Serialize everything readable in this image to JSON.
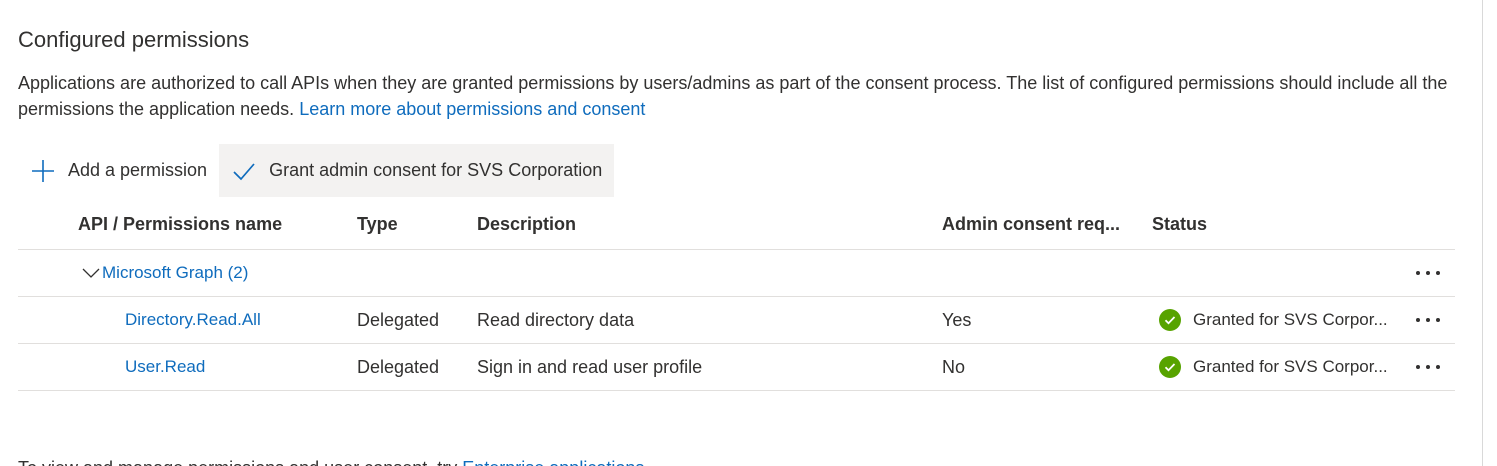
{
  "section": {
    "title": "Configured permissions",
    "intro_text": "Applications are authorized to call APIs when they are granted permissions by users/admins as part of the consent process. The list of configured permissions should include all the permissions the application needs.",
    "intro_link": "Learn more about permissions and consent"
  },
  "toolbar": {
    "add_label": "Add a permission",
    "grant_label": "Grant admin consent for SVS Corporation"
  },
  "table": {
    "headers": {
      "api": "API / Permissions name",
      "type": "Type",
      "description": "Description",
      "admin": "Admin consent req...",
      "status": "Status"
    },
    "group": {
      "label": "Microsoft Graph (2)"
    },
    "rows": [
      {
        "name": "Directory.Read.All",
        "type": "Delegated",
        "description": "Read directory data",
        "admin": "Yes",
        "status": "Granted for SVS Corpor..."
      },
      {
        "name": "User.Read",
        "type": "Delegated",
        "description": "Sign in and read user profile",
        "admin": "No",
        "status": "Granted for SVS Corpor..."
      }
    ]
  },
  "footer": {
    "text": "To view and manage permissions and user consent, try",
    "link": "Enterprise applications"
  },
  "colors": {
    "link": "#0f6cbd",
    "success": "#57a300",
    "toolbar_selected_bg": "#f3f2f1"
  },
  "icons": {
    "add": "plus-icon",
    "grant": "checkmark-icon",
    "expand": "chevron-down-icon",
    "status": "success-check-icon",
    "more": "more-ellipsis-icon"
  }
}
